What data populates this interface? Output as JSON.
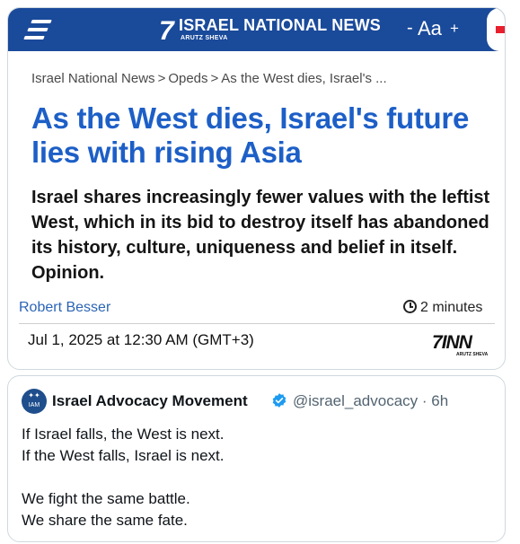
{
  "article": {
    "site_title": "ISRAEL NATIONAL NEWS",
    "site_subtitle": "ARUTZ SHEVA",
    "font_controls": {
      "minus": "-",
      "aa": "Aa",
      "plus": "+"
    },
    "breadcrumb": [
      "Israel National News",
      "Opeds",
      "As the West dies, Israel's ..."
    ],
    "breadcrumb_separator": ">",
    "headline": "As the West dies, Israel's future lies with rising Asia",
    "subheadline": "Israel shares increasingly fewer values with the leftist West, which in its bid to destroy itself has abandoned its history, culture, uniqueness and belief in itself. Opinion.",
    "author": "Robert Besser",
    "read_time": "2 minutes",
    "date": "Jul 1, 2025 at 12:30 AM (GMT+3)",
    "inn_logo_text": "INN",
    "inn_logo_sub": "ARUTZ SHEVA"
  },
  "tweet": {
    "avatar_text": "IAM",
    "display_name": "Israel Advocacy Movement",
    "handle_time": "@israel_advocacy · 6h",
    "body": "If Israel falls, the West is next.\nIf the West falls, Israel is next.\n\nWe fight the same battle.\nWe share the same fate."
  },
  "colors": {
    "topbar": "#1a4a9a",
    "headline": "#1d5fc7",
    "author": "#2b64b6",
    "verified": "#1d9bf0",
    "handle": "#536471"
  },
  "icons": [
    "menu-icon",
    "clock-icon",
    "verified-badge-icon",
    "avatar"
  ]
}
